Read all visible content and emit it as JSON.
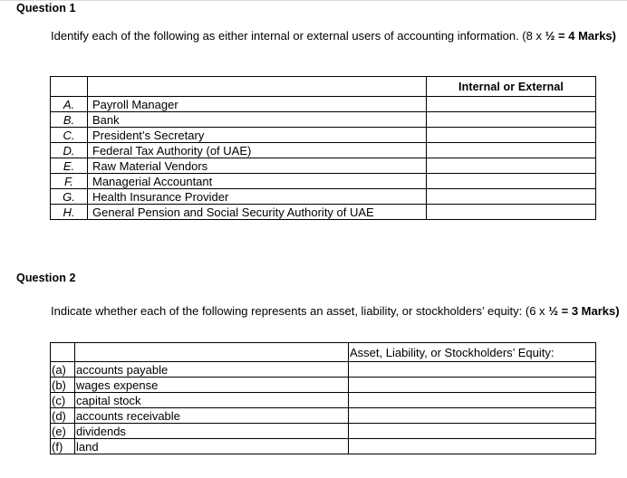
{
  "document": {
    "top_rule_color": "#d9d9d9",
    "text_color": "#000000",
    "background": "#ffffff"
  },
  "question1": {
    "heading": "Question 1",
    "prompt_main": "Identify each of the following as either internal or external users of accounting information. (8 x ",
    "prompt_marks": "½ = 4 Marks)",
    "table": {
      "header": {
        "letter": "",
        "item": "",
        "answer": "Internal or External"
      },
      "rows": [
        {
          "letter": "A.",
          "item": "Payroll Manager",
          "answer": ""
        },
        {
          "letter": "B.",
          "item": "Bank",
          "answer": ""
        },
        {
          "letter": "C.",
          "item": "President’s Secretary",
          "answer": ""
        },
        {
          "letter": "D.",
          "item": "Federal Tax Authority (of UAE)",
          "answer": ""
        },
        {
          "letter": "E.",
          "item": "Raw Material Vendors",
          "answer": ""
        },
        {
          "letter": "F.",
          "item": "Managerial Accountant",
          "answer": ""
        },
        {
          "letter": "G.",
          "item": "Health Insurance Provider",
          "answer": ""
        },
        {
          "letter": "H.",
          "item": "General Pension and Social Security Authority of UAE",
          "answer": ""
        }
      ]
    }
  },
  "question2": {
    "heading": "Question 2",
    "prompt_main": "Indicate whether each of the following represents an asset, liability, or stockholders’ equity: (6 x ",
    "prompt_marks": "½ = 3 Marks)",
    "table": {
      "header": {
        "letter": "",
        "item": "",
        "answer": "Asset, Liability, or Stockholders’ Equity:"
      },
      "rows": [
        {
          "letter": "(a)",
          "item": "accounts payable",
          "answer": ""
        },
        {
          "letter": "(b)",
          "item": "wages expense",
          "answer": ""
        },
        {
          "letter": "(c)",
          "item": "capital stock",
          "answer": ""
        },
        {
          "letter": "(d)",
          "item": "accounts receivable",
          "answer": ""
        },
        {
          "letter": "(e)",
          "item": "dividends",
          "answer": ""
        },
        {
          "letter": "(f)",
          "item": "land",
          "answer": ""
        }
      ]
    }
  }
}
